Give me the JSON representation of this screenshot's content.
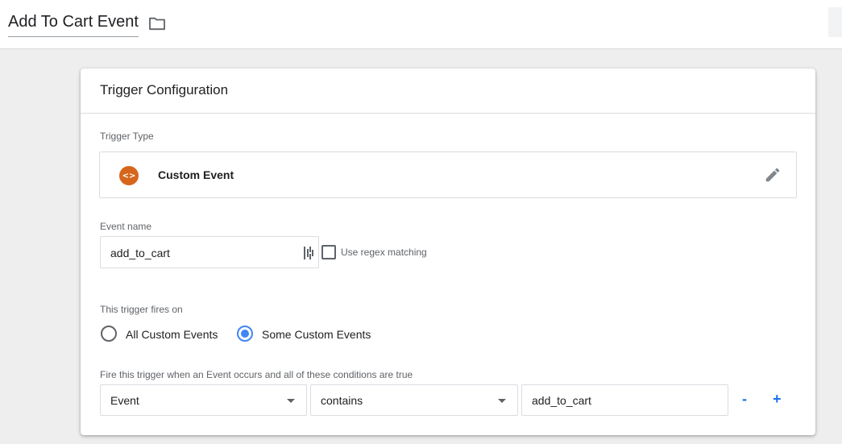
{
  "header": {
    "title": "Add To Cart Event",
    "folder_icon": "folder-icon"
  },
  "card": {
    "title": "Trigger Configuration",
    "trigger_type": {
      "label": "Trigger Type",
      "value": "Custom Event",
      "icon": "custom-event-icon",
      "icon_glyph": "<>",
      "icon_color": "#d7661d",
      "edit_icon": "pencil-icon"
    },
    "event_name": {
      "label": "Event name",
      "value": "add_to_cart",
      "variable_icon": "variable-picker-icon"
    },
    "regex": {
      "label": "Use regex matching",
      "checked": false
    },
    "fires_on": {
      "label": "This trigger fires on",
      "options": [
        {
          "label": "All Custom Events",
          "selected": false
        },
        {
          "label": "Some Custom Events",
          "selected": true
        }
      ]
    },
    "conditions": {
      "label": "Fire this trigger when an Event occurs and all of these conditions are true",
      "row": {
        "variable": "Event",
        "operator": "contains",
        "value": "add_to_cart"
      },
      "remove_label": "-",
      "add_label": "+"
    }
  },
  "colors": {
    "accent": "#4285f4",
    "link": "#1a73e8",
    "custom_event": "#d7661d"
  }
}
